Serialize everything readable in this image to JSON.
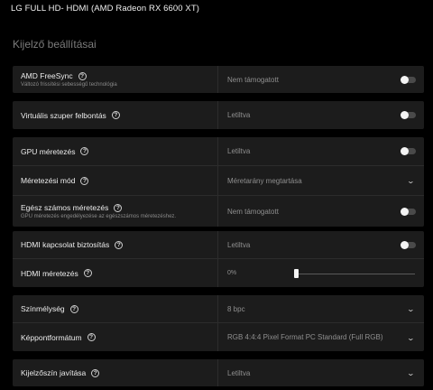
{
  "header": {
    "title": "LG FULL HD- HDMI (AMD Radeon RX 6600 XT)"
  },
  "section": {
    "title": "Kijelző beállításai"
  },
  "help_glyph": "?",
  "chevron_glyph": "⌄",
  "groups": [
    {
      "rows": [
        {
          "label": "AMD FreeSync",
          "desc": "Változó frissítési sebességű technológia",
          "value": "Nem támogatott",
          "control": "toggle",
          "toggle_on": false
        }
      ]
    },
    {
      "rows": [
        {
          "label": "Virtuális szuper felbontás",
          "value": "Letiltva",
          "control": "toggle",
          "toggle_on": false
        }
      ]
    },
    {
      "rows": [
        {
          "label": "GPU méretezés",
          "value": "Letiltva",
          "control": "toggle",
          "toggle_on": false
        },
        {
          "label": "Méretezési mód",
          "value": "Méretarány megtartása",
          "control": "dropdown"
        },
        {
          "label": "Egész számos méretezés",
          "desc": "GPU méretezés engedélyezése az egészszámos méretezéshez.",
          "value": "Nem támogatott",
          "control": "toggle",
          "toggle_on": false
        }
      ]
    },
    {
      "rows": [
        {
          "label": "HDMI kapcsolat biztosítás",
          "value": "Letiltva",
          "control": "toggle",
          "toggle_on": false
        },
        {
          "label": "HDMI méretezés",
          "value": "0%",
          "control": "slider",
          "slider_value": 0
        }
      ]
    },
    {
      "rows": [
        {
          "label": "Színmélység",
          "value": "8 bpc",
          "control": "dropdown"
        },
        {
          "label": "Képpontformátum",
          "value": "RGB 4:4:4 Pixel Format PC Standard (Full RGB)",
          "control": "dropdown"
        }
      ]
    },
    {
      "rows": [
        {
          "label": "Kijelzőszín javítása",
          "value": "Letiltva",
          "control": "dropdown"
        }
      ]
    }
  ]
}
